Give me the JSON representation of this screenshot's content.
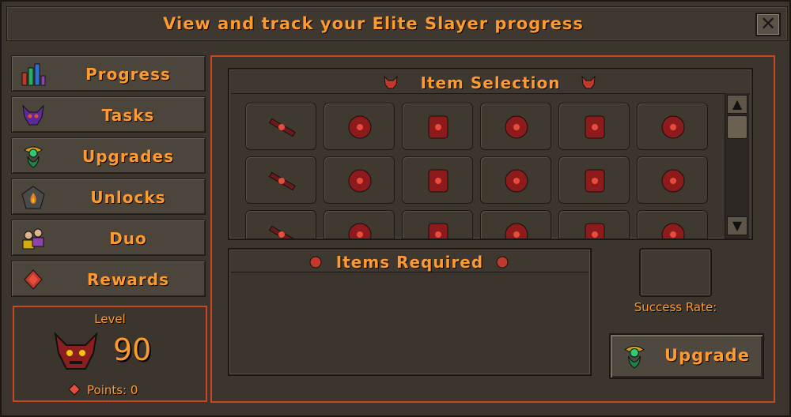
{
  "window": {
    "title": "View and track your Elite Slayer progress",
    "close_label": "✕"
  },
  "sidebar": {
    "items": [
      {
        "label": "Progress",
        "icon": "bar-chart-icon"
      },
      {
        "label": "Tasks",
        "icon": "demon-head-icon"
      },
      {
        "label": "Upgrades",
        "icon": "upgrade-orb-icon"
      },
      {
        "label": "Unlocks",
        "icon": "flame-badge-icon"
      },
      {
        "label": "Duo",
        "icon": "two-players-icon"
      },
      {
        "label": "Rewards",
        "icon": "red-gem-icon"
      }
    ]
  },
  "level": {
    "label": "Level",
    "value": "90",
    "points_label": "Points: 0"
  },
  "item_selection": {
    "title": "Item Selection",
    "items": [
      "scythe-weapon-icon",
      "helmet-icon",
      "platebody-icon",
      "platelegs-icon",
      "boots-icon",
      "gloves-icon",
      "staff-weapon-icon",
      "mage-hat-icon",
      "chestplate-icon",
      "robe-icon",
      "mage-boots-icon",
      "vambraces-icon",
      "bow-weapon-icon",
      "hood-icon",
      "body-armour-icon",
      "chaps-icon",
      "boots-icon",
      "gloves-icon"
    ]
  },
  "items_required": {
    "title": "Items Required"
  },
  "success": {
    "label": "Success Rate:"
  },
  "upgrade": {
    "label": "Upgrade"
  },
  "colors": {
    "accent": "#ff9a2e",
    "border": "#c8471f",
    "background": "#3b352e"
  }
}
